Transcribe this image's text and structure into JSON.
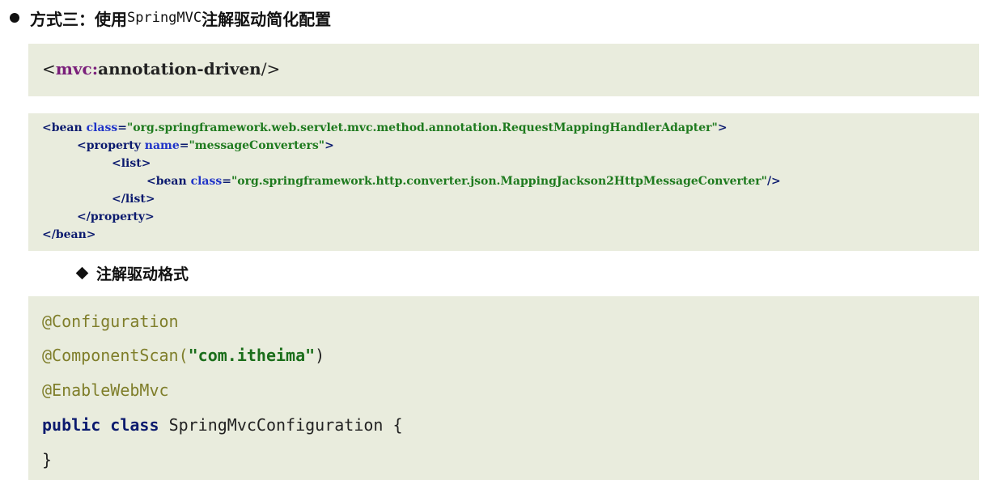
{
  "heading": {
    "prefix": "方式三：使用",
    "code": "SpringMVC",
    "suffix": "注解驱动简化配置"
  },
  "mvc_tag": {
    "open": "<",
    "prefix": "mvc",
    "colon": ":",
    "name": "annotation-driven",
    "close": "/>"
  },
  "xml_block": {
    "line1": {
      "open": "<bean ",
      "attr": "class",
      "eq": "=",
      "val": "\"org.springframework.web.servlet.mvc.method.annotation.RequestMappingHandlerAdapter\"",
      "close": ">"
    },
    "line2": {
      "open": "<property ",
      "attr": "name",
      "eq": "=",
      "val": "\"messageConverters\"",
      "close": ">"
    },
    "line3": {
      "tag": "<list>"
    },
    "line4": {
      "open": "<bean ",
      "attr": "class",
      "eq": "=",
      "val": "\"org.springframework.http.converter.json.MappingJackson2HttpMessageConverter\"",
      "close": "/>"
    },
    "line5": {
      "tag": "</list>"
    },
    "line6": {
      "tag": "</property>"
    },
    "line7": {
      "tag": "</bean>"
    }
  },
  "sub_heading": "注解驱动格式",
  "java_block": {
    "ann1": "@Configuration",
    "ann2": "@ComponentScan(",
    "ann2_str": "\"com.itheima\"",
    "ann2_close": ")",
    "ann3": "@EnableWebMvc",
    "kw_public": "public",
    "kw_class": "class",
    "class_name": "SpringMvcConfiguration {",
    "close_brace": "}"
  }
}
